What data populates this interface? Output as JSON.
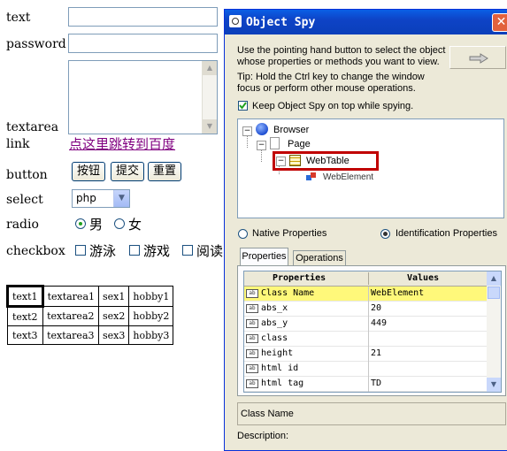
{
  "form": {
    "text_label": "text",
    "password_label": "password",
    "textarea_label": "textarea",
    "link_label": "link",
    "link_text": "点这里跳转到百度",
    "button_label": "button",
    "buttons": [
      "按钮",
      "提交",
      "重置"
    ],
    "select_label": "select",
    "select_value": "php",
    "radio_label": "radio",
    "radio_options": [
      "男",
      "女"
    ],
    "checkbox_label": "checkbox",
    "checkbox_options": [
      "游泳",
      "游戏",
      "阅读"
    ]
  },
  "table": {
    "rows": [
      [
        "text1",
        "textarea1",
        "sex1",
        "hobby1"
      ],
      [
        "text2",
        "textarea2",
        "sex2",
        "hobby2"
      ],
      [
        "text3",
        "textarea3",
        "sex3",
        "hobby3"
      ]
    ]
  },
  "spy": {
    "title": "Object Spy",
    "instructions": [
      "Use the pointing hand button to select the object",
      "whose properties or methods you want to view."
    ],
    "tip": [
      "Tip: Hold the Ctrl key to change the window",
      "focus or perform other mouse operations."
    ],
    "keep_on_top": "Keep Object Spy on top while spying.",
    "tree": [
      "Browser",
      "Page",
      "WebTable",
      "WebElement"
    ],
    "native_props": "Native Properties",
    "ident_props": "Identification Properties",
    "tabs": [
      "Properties",
      "Operations"
    ],
    "col_props": "Properties",
    "col_values": "Values",
    "rows": [
      {
        "name": "Class Name",
        "value": "WebElement"
      },
      {
        "name": "abs_x",
        "value": "20"
      },
      {
        "name": "abs_y",
        "value": "449"
      },
      {
        "name": "class",
        "value": ""
      },
      {
        "name": "height",
        "value": "21"
      },
      {
        "name": "html id",
        "value": ""
      },
      {
        "name": "html tag",
        "value": "TD"
      }
    ],
    "detail_label": "Class Name",
    "description_label": "Description:",
    "highlight_color": "#c00000"
  }
}
